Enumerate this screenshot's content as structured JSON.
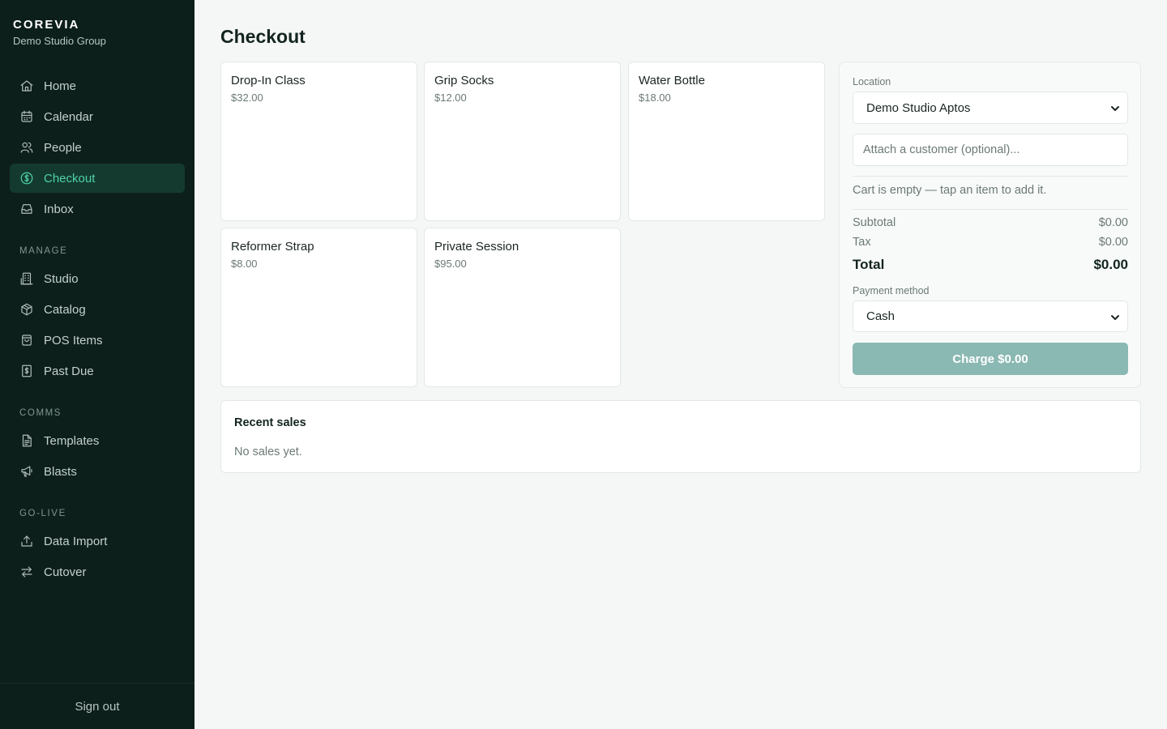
{
  "brand": {
    "name": "COREVIA",
    "org": "Demo Studio Group"
  },
  "nav": {
    "main": [
      {
        "label": "Home",
        "icon": "home-icon",
        "active": false
      },
      {
        "label": "Calendar",
        "icon": "calendar-icon",
        "active": false
      },
      {
        "label": "People",
        "icon": "people-icon",
        "active": false
      },
      {
        "label": "Checkout",
        "icon": "dollar-circle-icon",
        "active": true
      },
      {
        "label": "Inbox",
        "icon": "inbox-icon",
        "active": false
      }
    ],
    "manage_label": "MANAGE",
    "manage": [
      {
        "label": "Studio",
        "icon": "building-icon"
      },
      {
        "label": "Catalog",
        "icon": "package-icon"
      },
      {
        "label": "POS Items",
        "icon": "shopping-bag-icon"
      },
      {
        "label": "Past Due",
        "icon": "invoice-dollar-icon"
      }
    ],
    "comms_label": "COMMS",
    "comms": [
      {
        "label": "Templates",
        "icon": "document-icon"
      },
      {
        "label": "Blasts",
        "icon": "megaphone-icon"
      }
    ],
    "golive_label": "GO-LIVE",
    "golive": [
      {
        "label": "Data Import",
        "icon": "upload-icon"
      },
      {
        "label": "Cutover",
        "icon": "arrows-swap-icon"
      }
    ],
    "signout": "Sign out"
  },
  "page": {
    "title": "Checkout"
  },
  "items": [
    {
      "name": "Drop-In Class",
      "price": "$32.00"
    },
    {
      "name": "Grip Socks",
      "price": "$12.00"
    },
    {
      "name": "Water Bottle",
      "price": "$18.00"
    },
    {
      "name": "Reformer Strap",
      "price": "$8.00"
    },
    {
      "name": "Private Session",
      "price": "$95.00"
    }
  ],
  "cart": {
    "location_label": "Location",
    "location_value": "Demo Studio Aptos",
    "customer_placeholder": "Attach a customer (optional)...",
    "empty_text": "Cart is empty — tap an item to add it.",
    "subtotal_label": "Subtotal",
    "subtotal_value": "$0.00",
    "tax_label": "Tax",
    "tax_value": "$0.00",
    "total_label": "Total",
    "total_value": "$0.00",
    "payment_label": "Payment method",
    "payment_value": "Cash",
    "charge_label": "Charge $0.00"
  },
  "recent": {
    "title": "Recent sales",
    "empty_text": "No sales yet."
  },
  "colors": {
    "sidebar": "#0d1f1b",
    "accent": "#4fd1a8",
    "active_bg": "#143a30",
    "charge_button": "#8ab8b2"
  }
}
